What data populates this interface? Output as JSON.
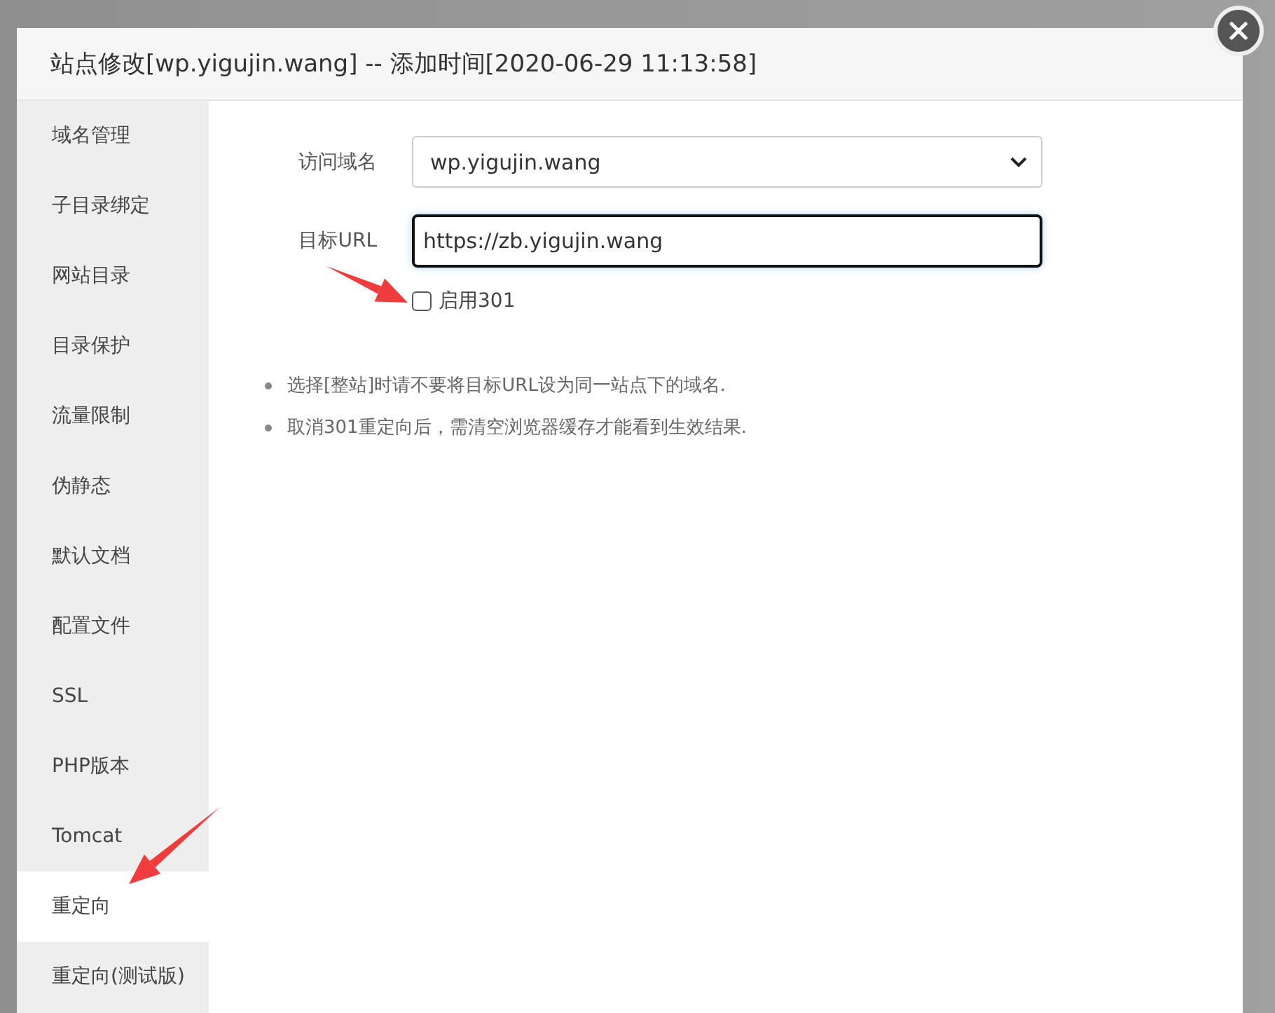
{
  "dialog": {
    "title": "站点修改[wp.yigujin.wang] -- 添加时间[2020-06-29 11:13:58]"
  },
  "sidebar": {
    "items": [
      {
        "label": "域名管理",
        "selected": false
      },
      {
        "label": "子目录绑定",
        "selected": false
      },
      {
        "label": "网站目录",
        "selected": false
      },
      {
        "label": "目录保护",
        "selected": false
      },
      {
        "label": "流量限制",
        "selected": false
      },
      {
        "label": "伪静态",
        "selected": false
      },
      {
        "label": "默认文档",
        "selected": false
      },
      {
        "label": "配置文件",
        "selected": false
      },
      {
        "label": "SSL",
        "selected": false
      },
      {
        "label": "PHP版本",
        "selected": false
      },
      {
        "label": "Tomcat",
        "selected": false
      },
      {
        "label": "重定向",
        "selected": true
      },
      {
        "label": "重定向(测试版)",
        "selected": false
      }
    ]
  },
  "form": {
    "domain": {
      "label": "访问域名",
      "value": "wp.yigujin.wang"
    },
    "target": {
      "label": "目标URL",
      "value": "https://zb.yigujin.wang",
      "focused": true
    },
    "enable301": {
      "label": "启用301",
      "checked": false
    }
  },
  "notes": [
    "选择[整站]时请不要将目标URL设为同一站点下的域名.",
    "取消301重定向后，需清空浏览器缓存才能看到生效结果."
  ]
}
